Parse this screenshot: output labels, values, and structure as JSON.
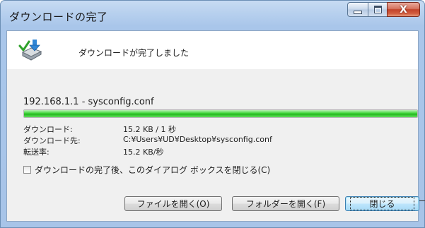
{
  "window": {
    "title": "ダウンロードの完了",
    "controls": {
      "minimize": "minimize-icon",
      "maximize": "maximize-icon",
      "close": "close-icon",
      "close_glyph": "X"
    }
  },
  "status": {
    "icon": "download-complete-icon",
    "message": "ダウンロードが完了しました"
  },
  "download": {
    "source": "192.168.1.1 - sysconfig.conf",
    "progress_percent": 100,
    "rows": [
      {
        "label": "ダウンロード:",
        "value": "15.2 KB / 1 秒"
      },
      {
        "label": "ダウンロード先:",
        "value": "C:¥Users¥UD¥Desktop¥sysconfig.conf"
      },
      {
        "label": "転送率:",
        "value": "15.2 KB/秒"
      }
    ]
  },
  "close_on_complete": {
    "checked": false,
    "label": "ダウンロードの完了後、このダイアログ ボックスを閉じる(C)"
  },
  "buttons": {
    "open_file": "ファイルを開く(O)",
    "open_folder": "フォルダーを開く(F)",
    "close": "閉じる"
  },
  "colors": {
    "title_bar": "#b7d0ee",
    "progress": "#22b51c",
    "close_button": "#c2432a"
  }
}
